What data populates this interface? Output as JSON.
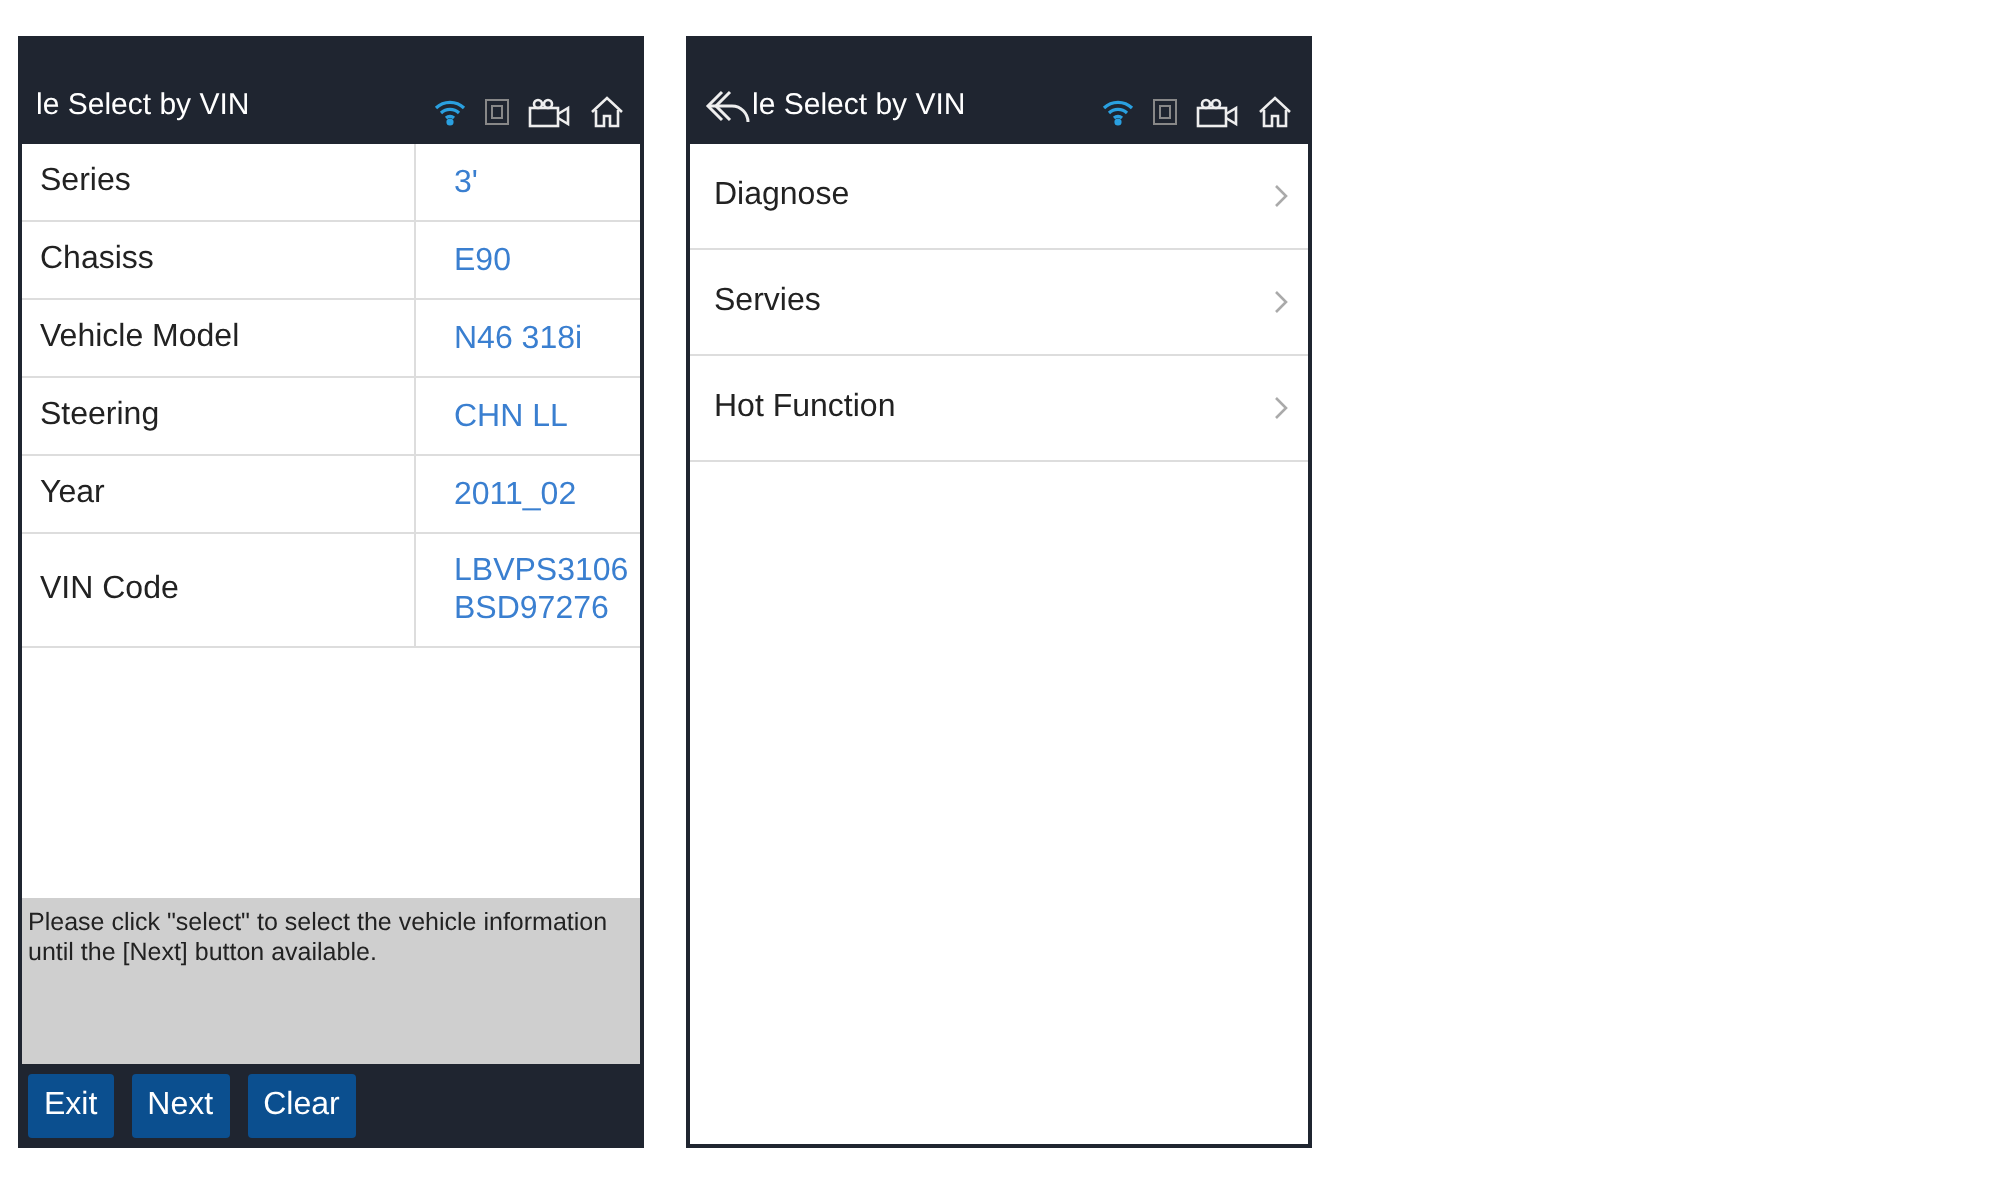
{
  "left_screen": {
    "title": "le Select by VIN",
    "rows": [
      {
        "label": "Series",
        "value": "3'"
      },
      {
        "label": "Chasiss",
        "value": "E90"
      },
      {
        "label": "Vehicle Model",
        "value": "N46 318i"
      },
      {
        "label": "Steering",
        "value": "CHN LL"
      },
      {
        "label": "Year",
        "value": "2011_02"
      },
      {
        "label": "VIN Code",
        "value": "LBVPS3106\nBSD97276"
      }
    ],
    "hint": "Please click \"select\" to select the vehicle information until the [Next] button available.",
    "buttons": [
      "Exit",
      "Next",
      "Clear"
    ]
  },
  "right_screen": {
    "title": "le Select by VIN",
    "menu_items": [
      "Diagnose",
      "Servies",
      "Hot Function"
    ]
  }
}
